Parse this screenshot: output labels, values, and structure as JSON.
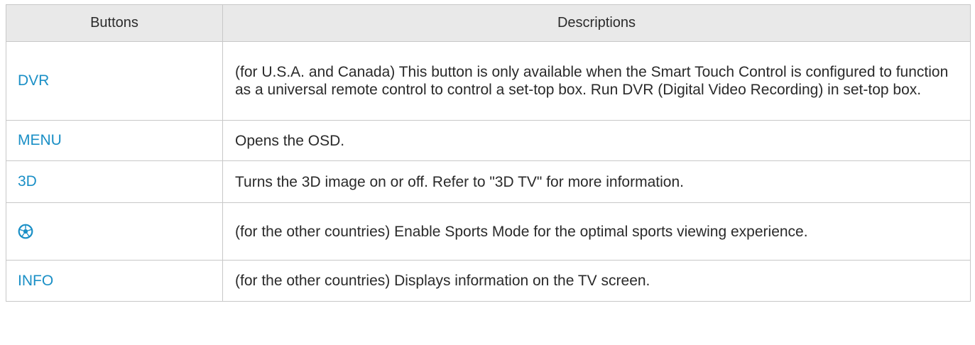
{
  "table": {
    "headers": {
      "buttons": "Buttons",
      "descriptions": "Descriptions"
    },
    "rows": [
      {
        "button": "DVR",
        "description": "(for U.S.A. and Canada) This button is only available when the Smart Touch Control is configured to function as a universal remote control to control a set-top box. Run DVR (Digital Video Recording) in set-top box."
      },
      {
        "button": "MENU",
        "description": "Opens the OSD."
      },
      {
        "button": "3D",
        "description": "Turns the 3D image on or off. Refer to \"3D TV\" for more information."
      },
      {
        "button_icon": "soccer-ball-icon",
        "description": "(for the other countries) Enable Sports Mode for the optimal sports viewing experience."
      },
      {
        "button": "INFO",
        "description": "(for the other countries) Displays information on the TV screen."
      }
    ]
  },
  "colors": {
    "header_background": "#e9e9e9",
    "button_text": "#1a8fc6",
    "border": "#c8c8c8",
    "body_text": "#2a2a2a"
  }
}
